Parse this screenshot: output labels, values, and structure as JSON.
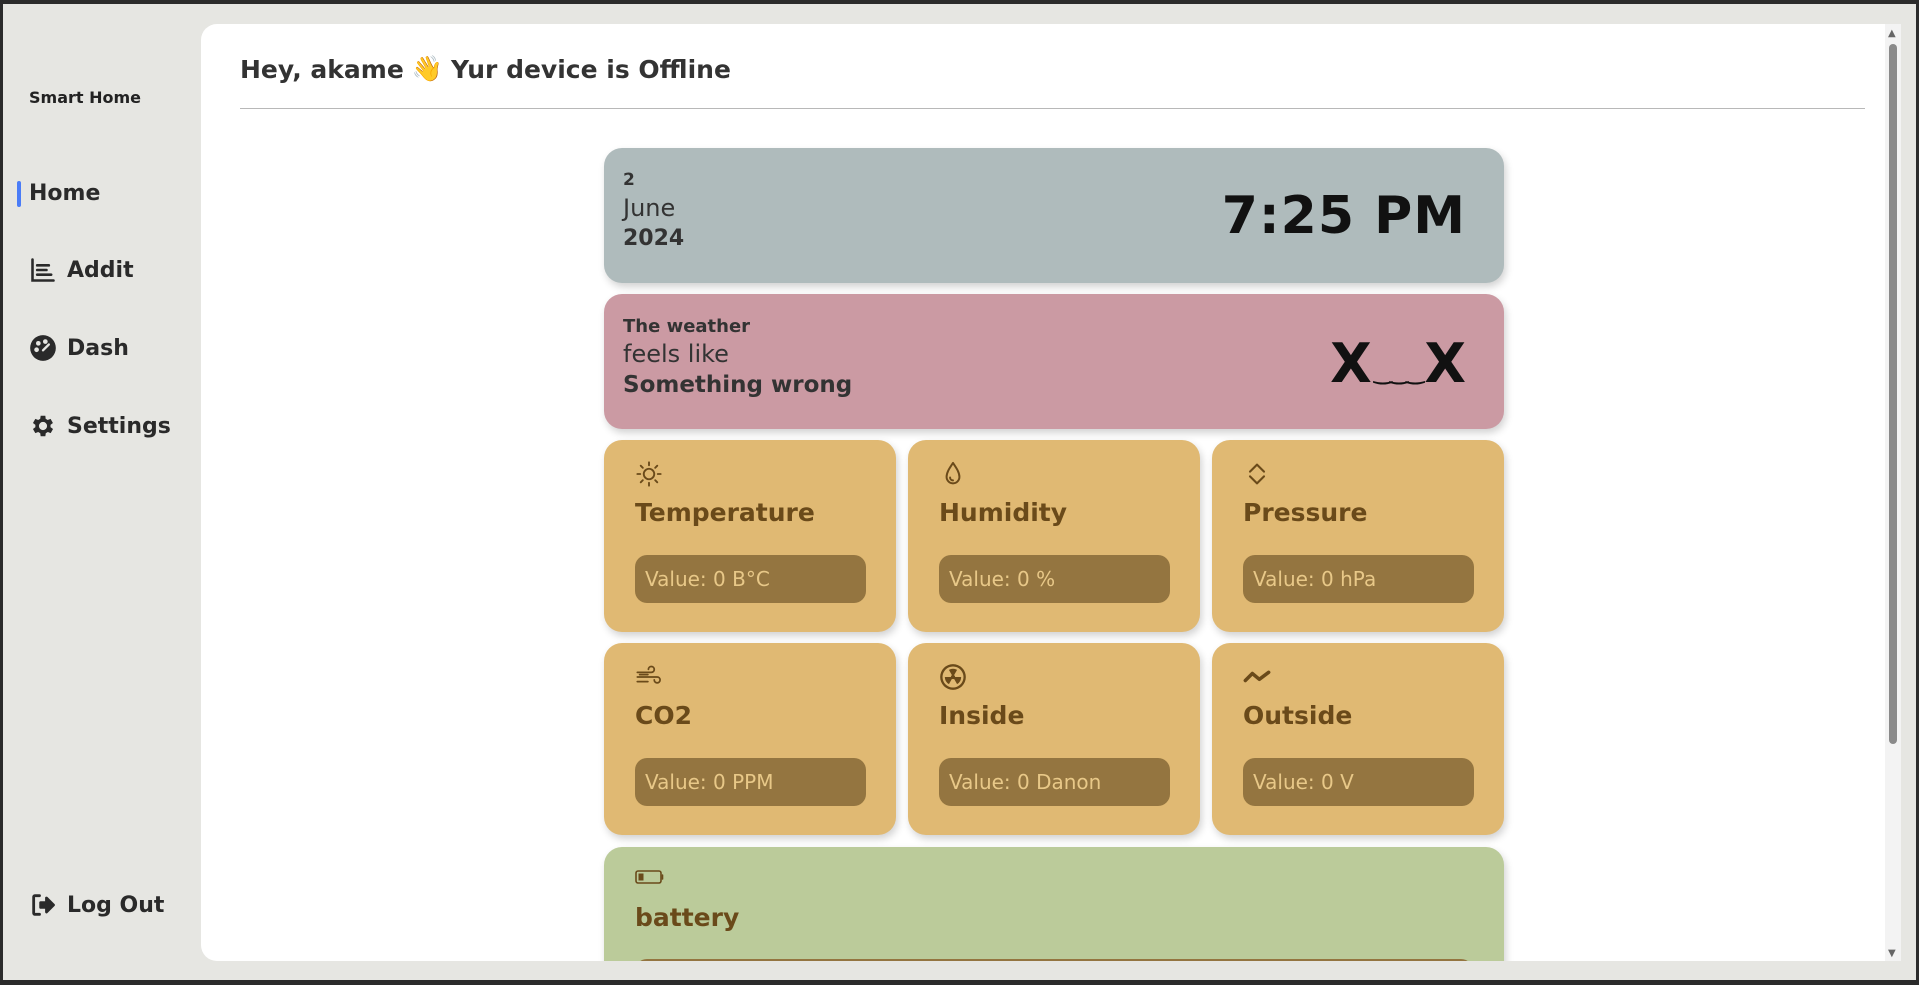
{
  "sidebar": {
    "brand": "Smart Home",
    "items": [
      {
        "label": "Home",
        "icon": "home",
        "active": true
      },
      {
        "label": "Addit",
        "icon": "bar-chart-icon"
      },
      {
        "label": "Dash",
        "icon": "palette-icon"
      },
      {
        "label": "Settings",
        "icon": "gear-icon"
      }
    ],
    "logout": {
      "label": "Log Out",
      "icon": "logout-icon"
    }
  },
  "header": {
    "greeting": "Hey, akame",
    "wave": "👋",
    "status": "Yur device is Offline"
  },
  "datetime": {
    "day": "2",
    "month": "June",
    "year": "2024",
    "time": "7:25 PM"
  },
  "weather": {
    "title": "The weather",
    "feels": "feels like",
    "status": "Something wrong",
    "face_left": "X",
    "face_mouth": "‿‿‿",
    "face_right": "X"
  },
  "sensors": [
    {
      "title": "Temperature",
      "value": "Value: 0 B°C",
      "icon": "sun-icon"
    },
    {
      "title": "Humidity",
      "value": "Value: 0 %",
      "icon": "droplet-icon"
    },
    {
      "title": "Pressure",
      "value": "Value: 0 hPa",
      "icon": "diamond-arrows-icon"
    },
    {
      "title": "CO2",
      "value": "Value: 0 PPM",
      "icon": "wind-icon"
    },
    {
      "title": "Inside",
      "value": "Value: 0 Danon",
      "icon": "radiation-icon"
    },
    {
      "title": "Outside",
      "value": "Value: 0 V",
      "icon": "wave-icon"
    }
  ],
  "battery": {
    "title": "battery",
    "icon": "battery-icon"
  },
  "colors": {
    "accent": "#4a7cf7",
    "date_card": "#afbbbc",
    "weather_card": "#cb9aa3",
    "sensor_card": "#e0b973",
    "sensor_value_bg": "#947540",
    "battery_card": "#bbcb9a"
  }
}
